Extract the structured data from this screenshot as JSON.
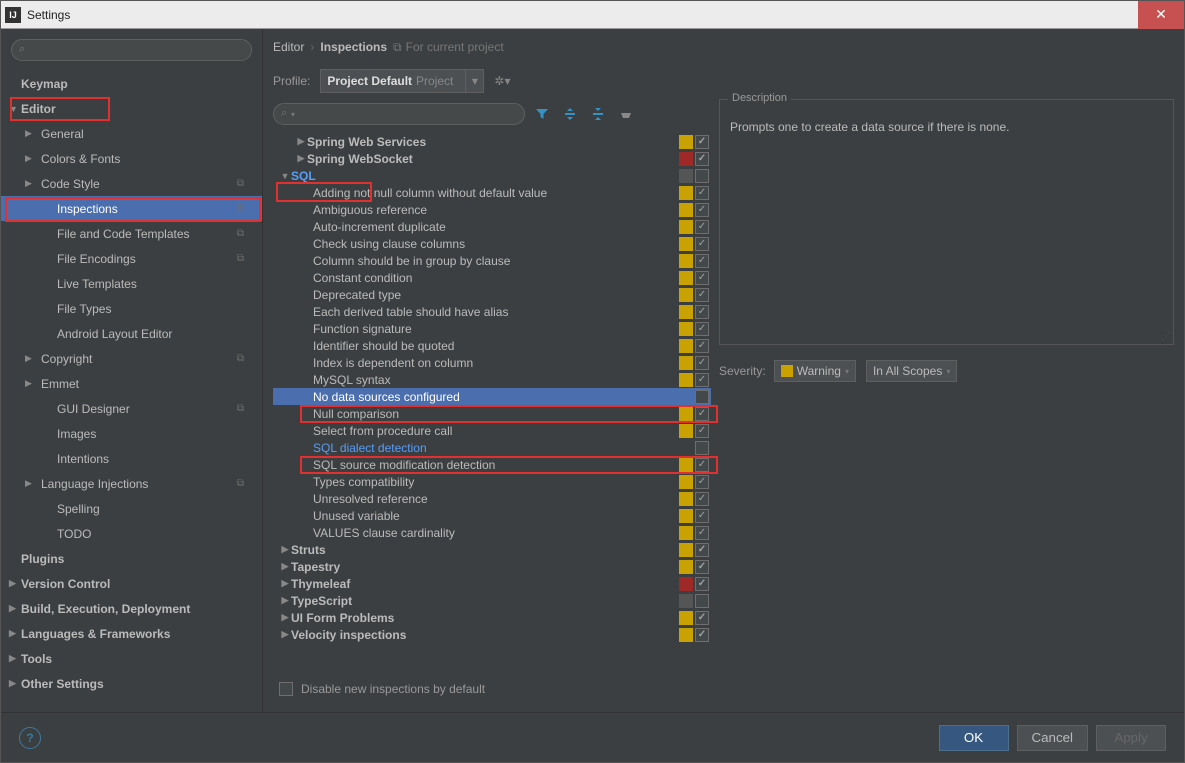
{
  "window": {
    "title": "Settings"
  },
  "breadcrumb": {
    "seg1": "Editor",
    "seg2": "Inspections",
    "for_project": "For current project"
  },
  "profile": {
    "label": "Profile:",
    "name": "Project Default",
    "scope": "Project"
  },
  "sidebar": {
    "items": [
      {
        "label": "Keymap",
        "level": 0,
        "bold": true,
        "arrow": ""
      },
      {
        "label": "Editor",
        "level": 0,
        "bold": true,
        "arrow": "▼"
      },
      {
        "label": "General",
        "level": 1,
        "arrow": "▶"
      },
      {
        "label": "Colors & Fonts",
        "level": 1,
        "arrow": "▶"
      },
      {
        "label": "Code Style",
        "level": 1,
        "arrow": "▶",
        "copy": true
      },
      {
        "label": "Inspections",
        "level": 2,
        "selected": true,
        "copy": true
      },
      {
        "label": "File and Code Templates",
        "level": 2,
        "copy": true
      },
      {
        "label": "File Encodings",
        "level": 2,
        "copy": true
      },
      {
        "label": "Live Templates",
        "level": 2
      },
      {
        "label": "File Types",
        "level": 2
      },
      {
        "label": "Android Layout Editor",
        "level": 2
      },
      {
        "label": "Copyright",
        "level": 1,
        "arrow": "▶",
        "copy": true
      },
      {
        "label": "Emmet",
        "level": 1,
        "arrow": "▶"
      },
      {
        "label": "GUI Designer",
        "level": 2,
        "copy": true
      },
      {
        "label": "Images",
        "level": 2
      },
      {
        "label": "Intentions",
        "level": 2
      },
      {
        "label": "Language Injections",
        "level": 1,
        "arrow": "▶",
        "copy": true
      },
      {
        "label": "Spelling",
        "level": 2
      },
      {
        "label": "TODO",
        "level": 2
      },
      {
        "label": "Plugins",
        "level": 0,
        "bold": true
      },
      {
        "label": "Version Control",
        "level": 0,
        "bold": true,
        "arrow": "▶"
      },
      {
        "label": "Build, Execution, Deployment",
        "level": 0,
        "bold": true,
        "arrow": "▶"
      },
      {
        "label": "Languages & Frameworks",
        "level": 0,
        "bold": true,
        "arrow": "▶"
      },
      {
        "label": "Tools",
        "level": 0,
        "bold": true,
        "arrow": "▶"
      },
      {
        "label": "Other Settings",
        "level": 0,
        "bold": true,
        "arrow": "▶"
      }
    ]
  },
  "inspections": {
    "rows": [
      {
        "type": "cat",
        "level": 1,
        "arrow": "▶",
        "label": "Spring Web Services",
        "sev": "warning",
        "checked": true
      },
      {
        "type": "cat",
        "level": 1,
        "arrow": "▶",
        "label": "Spring WebSocket",
        "sev": "error",
        "checked": true
      },
      {
        "type": "cat",
        "level": 0,
        "arrow": "▼",
        "label": "SQL",
        "blue": true,
        "sev": "none",
        "checked": false
      },
      {
        "type": "item",
        "label": "Adding not null column without default value",
        "sev": "warning",
        "checked": true
      },
      {
        "type": "item",
        "label": "Ambiguous reference",
        "sev": "warning",
        "checked": true
      },
      {
        "type": "item",
        "label": "Auto-increment duplicate",
        "sev": "warning",
        "checked": true
      },
      {
        "type": "item",
        "label": "Check using clause columns",
        "sev": "warning",
        "checked": true
      },
      {
        "type": "item",
        "label": "Column should be in group by clause",
        "sev": "warning",
        "checked": true
      },
      {
        "type": "item",
        "label": "Constant condition",
        "sev": "warning",
        "checked": true
      },
      {
        "type": "item",
        "label": "Deprecated type",
        "sev": "warning",
        "checked": true
      },
      {
        "type": "item",
        "label": "Each derived table should have alias",
        "sev": "warning",
        "checked": true
      },
      {
        "type": "item",
        "label": "Function signature",
        "sev": "warning",
        "checked": true
      },
      {
        "type": "item",
        "label": "Identifier should be quoted",
        "sev": "warning",
        "checked": true
      },
      {
        "type": "item",
        "label": "Index is dependent on column",
        "sev": "warning",
        "checked": true
      },
      {
        "type": "item",
        "label": "MySQL syntax",
        "sev": "warning",
        "checked": true
      },
      {
        "type": "item",
        "label": "No data sources configured",
        "selected": true,
        "sev": "",
        "checked": false
      },
      {
        "type": "item",
        "label": "Null comparison",
        "sev": "warning",
        "checked": true
      },
      {
        "type": "item",
        "label": "Select from procedure call",
        "sev": "warning",
        "checked": true
      },
      {
        "type": "item",
        "label": "SQL dialect detection",
        "blue": true,
        "sev": "",
        "checked": false
      },
      {
        "type": "item",
        "label": "SQL source modification detection",
        "sev": "warning",
        "checked": true
      },
      {
        "type": "item",
        "label": "Types compatibility",
        "sev": "warning",
        "checked": true
      },
      {
        "type": "item",
        "label": "Unresolved reference",
        "sev": "warning",
        "checked": true
      },
      {
        "type": "item",
        "label": "Unused variable",
        "sev": "warning",
        "checked": true
      },
      {
        "type": "item",
        "label": "VALUES clause cardinality",
        "sev": "warning",
        "checked": true
      },
      {
        "type": "cat",
        "level": 0,
        "arrow": "▶",
        "label": "Struts",
        "sev": "warning",
        "checked": true
      },
      {
        "type": "cat",
        "level": 0,
        "arrow": "▶",
        "label": "Tapestry",
        "sev": "warning",
        "checked": true
      },
      {
        "type": "cat",
        "level": 0,
        "arrow": "▶",
        "label": "Thymeleaf",
        "sev": "error",
        "checked": true
      },
      {
        "type": "cat",
        "level": 0,
        "arrow": "▶",
        "label": "TypeScript",
        "sev": "none",
        "checked": false
      },
      {
        "type": "cat",
        "level": 0,
        "arrow": "▶",
        "label": "UI Form Problems",
        "sev": "warning",
        "checked": true
      },
      {
        "type": "cat",
        "level": 0,
        "arrow": "▶",
        "label": "Velocity inspections",
        "sev": "warning",
        "checked": true
      }
    ],
    "disable_label": "Disable new inspections by default"
  },
  "description": {
    "legend": "Description",
    "text": "Prompts one to create a data source if there is none."
  },
  "severity": {
    "label": "Severity:",
    "value": "Warning",
    "scope": "In All Scopes"
  },
  "buttons": {
    "ok": "OK",
    "cancel": "Cancel",
    "apply": "Apply"
  }
}
